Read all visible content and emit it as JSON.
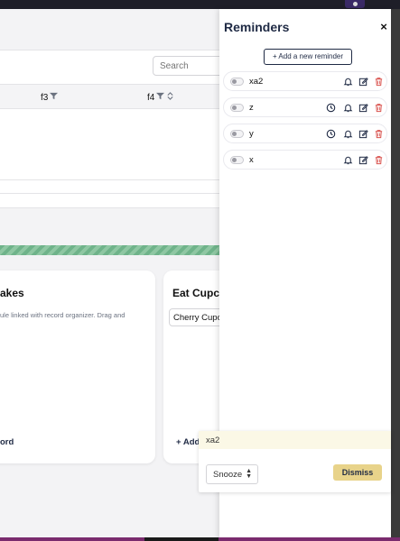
{
  "table": {
    "search_placeholder": "Search",
    "columns": [
      {
        "label": "f3"
      },
      {
        "label": "f4"
      }
    ]
  },
  "cards": [
    {
      "title": "akes",
      "description": "ule linked with record organizer. Drag and",
      "footer": "ord"
    },
    {
      "title": "Eat Cupca",
      "chip": "Cherry Cupca",
      "footer": "+ Add"
    }
  ],
  "drawer": {
    "title": "Reminders",
    "close_label": "×",
    "add_label": "+ Add a new reminder",
    "reminders": [
      {
        "label": "xa2",
        "has_clock": false
      },
      {
        "label": "z",
        "has_clock": true
      },
      {
        "label": "y",
        "has_clock": true
      },
      {
        "label": "x",
        "has_clock": false
      }
    ]
  },
  "popup": {
    "reminder_name": "xa2",
    "snooze_label": "Snooze",
    "dismiss_label": "Dismiss"
  },
  "colors": {
    "accent": "#1f2a44",
    "dismiss_bg": "#e8d38a",
    "trash": "#d9534f",
    "popup_header": "#fbf8e6",
    "stripe": "#6fb38a"
  },
  "icons": {
    "filter": "filter-icon",
    "sort": "sort-icon",
    "clock": "clock-icon",
    "bell": "bell-icon",
    "edit": "edit-icon",
    "trash": "trash-icon"
  }
}
